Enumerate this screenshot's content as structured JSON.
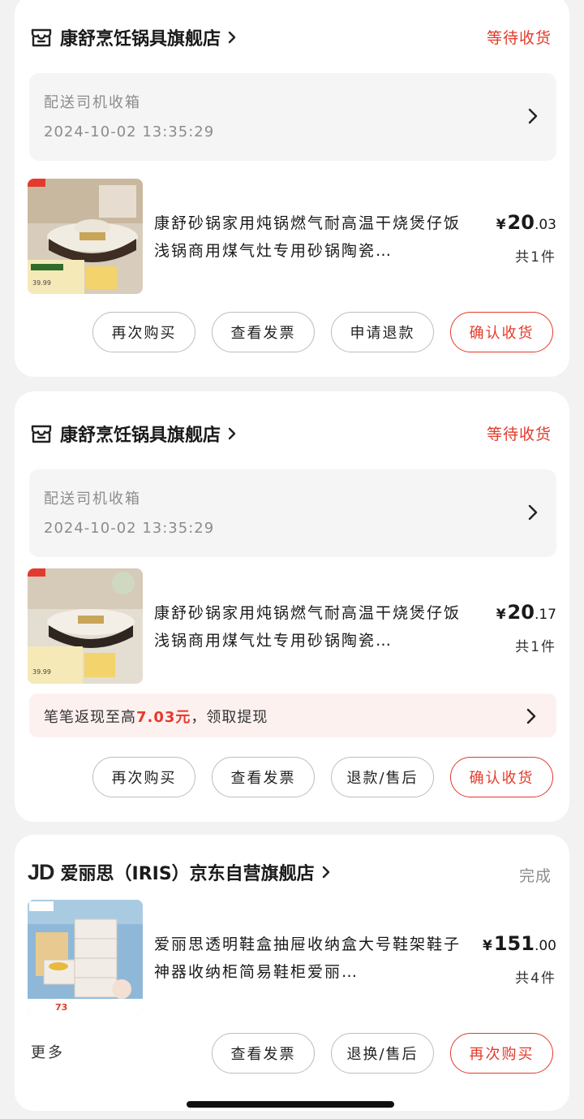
{
  "orders": [
    {
      "store_name": "康舒烹饪锅具旗舰店",
      "status": "等待收货",
      "delivery": {
        "title": "配送司机收箱",
        "time": "2024-10-02 13:35:29"
      },
      "product": {
        "title": "康舒砂锅家用炖锅燃气耐高温干烧煲仔饭浅锅商用煤气灶专用砂锅陶瓷…",
        "price_symbol": "¥",
        "price_int": "20",
        "price_dec": ".03",
        "quantity": "共1件",
        "thumb_price": "39.99"
      },
      "buttons": [
        "再次购买",
        "查看发票",
        "申请退款",
        "确认收货"
      ]
    },
    {
      "store_name": "康舒烹饪锅具旗舰店",
      "status": "等待收货",
      "delivery": {
        "title": "配送司机收箱",
        "time": "2024-10-02 13:35:29"
      },
      "product": {
        "title": "康舒砂锅家用炖锅燃气耐高温干烧煲仔饭浅锅商用煤气灶专用砂锅陶瓷…",
        "price_symbol": "¥",
        "price_int": "20",
        "price_dec": ".17",
        "quantity": "共1件",
        "thumb_price": "39.99"
      },
      "cashback": {
        "prefix": "笔笔返现至高",
        "amount": "7.03元",
        "suffix": "，领取提现"
      },
      "buttons": [
        "再次购买",
        "查看发票",
        "退款/售后",
        "确认收货"
      ]
    },
    {
      "store_logo": "JD",
      "store_name": "爱丽思（IRIS）京东自营旗舰店",
      "status": "完成",
      "product": {
        "title": "爱丽思透明鞋盒抽屉收纳盒大号鞋架鞋子神器收纳柜简易鞋柜爱丽…",
        "price_symbol": "¥",
        "price_int": "151",
        "price_dec": ".00",
        "quantity": "共4件",
        "thumb_price": "73"
      },
      "more_label": "更多",
      "buttons": [
        "查看发票",
        "退换/售后",
        "再次购买"
      ]
    }
  ],
  "colors": {
    "accent": "#e33a2b",
    "background": "#f2f2f2",
    "card": "#ffffff"
  },
  "icons": [
    "store-icon",
    "chevron-right-icon"
  ]
}
